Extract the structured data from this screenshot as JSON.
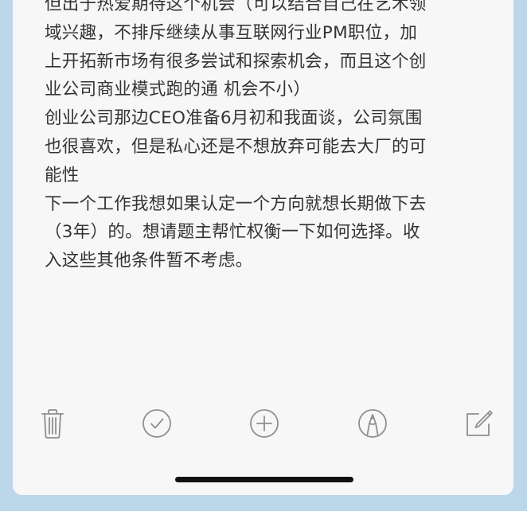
{
  "note": {
    "lines": [
      "但出于热爱期待这个机会（可以结合自己在艺术领",
      "域兴趣，不排斥继续从事互联网行业PM职位，加",
      "上开拓新市场有很多尝试和探索机会，而且这个创",
      "业公司商业模式跑的通 机会不小）",
      "创业公司那边CEO准备6月初和我面谈，公司氛围",
      "也很喜欢，但是私心还是不想放弃可能去大厂的可",
      "能性",
      "下一个工作我想如果认定一个方向就想长期做下去",
      "（3年）的。想请题主帮忙权衡一下如何选择。收",
      "入这些其他条件暂不考虑。"
    ]
  },
  "toolbar": {
    "icons": [
      "trash-icon",
      "checklist-icon",
      "add-icon",
      "markup-icon",
      "compose-icon"
    ]
  },
  "colors": {
    "accent": "#8e8e93",
    "text": "#333333",
    "background": "#f7f7f7",
    "frame": "#bcd6ea"
  }
}
